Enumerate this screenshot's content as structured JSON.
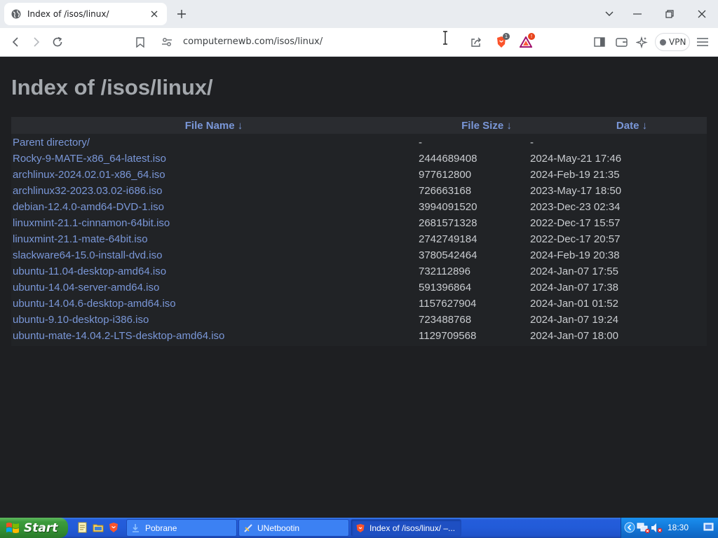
{
  "browser": {
    "tab": {
      "title": "Index of /isos/linux/",
      "favicon": "globe-icon"
    },
    "url": "computernewb.com/isos/linux/",
    "vpn_label": "VPN",
    "shields_count": "1"
  },
  "page": {
    "heading": "Index of /isos/linux/",
    "columns": {
      "name": "File Name  ↓",
      "size": "File Size  ↓",
      "date": "Date  ↓"
    },
    "rows": [
      {
        "name": "Parent directory/",
        "size": "-",
        "date": "-"
      },
      {
        "name": "Rocky-9-MATE-x86_64-latest.iso",
        "size": "2444689408",
        "date": "2024-May-21 17:46"
      },
      {
        "name": "archlinux-2024.02.01-x86_64.iso",
        "size": "977612800",
        "date": "2024-Feb-19 21:35"
      },
      {
        "name": "archlinux32-2023.03.02-i686.iso",
        "size": "726663168",
        "date": "2023-May-17 18:50"
      },
      {
        "name": "debian-12.4.0-amd64-DVD-1.iso",
        "size": "3994091520",
        "date": "2023-Dec-23 02:34"
      },
      {
        "name": "linuxmint-21.1-cinnamon-64bit.iso",
        "size": "2681571328",
        "date": "2022-Dec-17 15:57"
      },
      {
        "name": "linuxmint-21.1-mate-64bit.iso",
        "size": "2742749184",
        "date": "2022-Dec-17 20:57"
      },
      {
        "name": "slackware64-15.0-install-dvd.iso",
        "size": "3780542464",
        "date": "2024-Feb-19 20:38"
      },
      {
        "name": "ubuntu-11.04-desktop-amd64.iso",
        "size": "732112896",
        "date": "2024-Jan-07 17:55"
      },
      {
        "name": "ubuntu-14.04-server-amd64.iso",
        "size": "591396864",
        "date": "2024-Jan-07 17:38"
      },
      {
        "name": "ubuntu-14.04.6-desktop-amd64.iso",
        "size": "1157627904",
        "date": "2024-Jan-01 01:52"
      },
      {
        "name": "ubuntu-9.10-desktop-i386.iso",
        "size": "723488768",
        "date": "2024-Jan-07 19:24"
      },
      {
        "name": "ubuntu-mate-14.04.2-LTS-desktop-amd64.iso",
        "size": "1129709568",
        "date": "2024-Jan-07 18:00"
      }
    ]
  },
  "taskbar": {
    "start_label": "Start",
    "tasks": [
      {
        "label": "Pobrane",
        "icon": "folder-icon"
      },
      {
        "label": "UNetbootin",
        "icon": "unetbootin-icon"
      },
      {
        "label": "Index of /isos/linux/ –...",
        "icon": "brave-icon"
      }
    ],
    "clock": "18:30"
  },
  "colors": {
    "page_bg": "#1e1f22",
    "link": "#7a97d8",
    "heading": "#a4a8ad",
    "taskbar": "#245ddb",
    "start": "#3d9c3d"
  }
}
